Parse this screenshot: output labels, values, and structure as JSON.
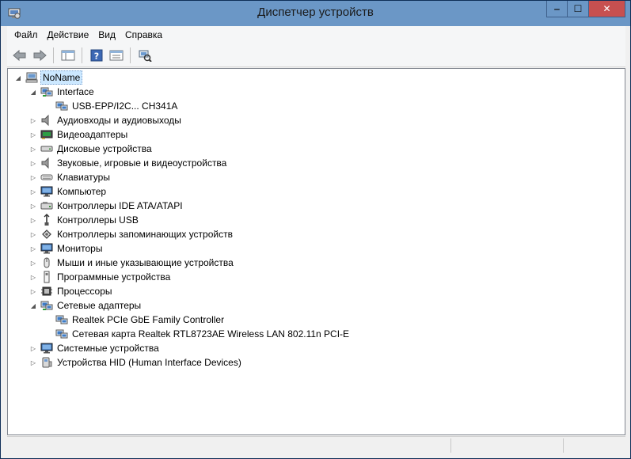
{
  "window": {
    "title": "Диспетчер устройств",
    "minimize_glyph": "‒",
    "maximize_glyph": "☐",
    "close_glyph": "✕"
  },
  "menu": [
    "Файл",
    "Действие",
    "Вид",
    "Справка"
  ],
  "toolbar": {
    "buttons": [
      "back-icon",
      "forward-icon",
      "show-hide-console-tree-icon",
      "help-icon",
      "properties-icon",
      "scan-hardware-icon"
    ]
  },
  "tree": {
    "root": {
      "label": "NoName",
      "icon": "computer-icon",
      "expanded": true
    },
    "items": [
      {
        "label": "Interface",
        "level": 1,
        "expander": "open",
        "icon": "network-icon"
      },
      {
        "label": "USB-EPP/I2C... CH341A",
        "level": 2,
        "expander": "none",
        "icon": "network-device-icon"
      },
      {
        "label": "Аудиовходы и аудиовыходы",
        "level": 1,
        "expander": "closed",
        "icon": "speaker-icon"
      },
      {
        "label": "Видеоадаптеры",
        "level": 1,
        "expander": "closed",
        "icon": "display-adapter-icon"
      },
      {
        "label": "Дисковые устройства",
        "level": 1,
        "expander": "closed",
        "icon": "disk-icon"
      },
      {
        "label": "Звуковые, игровые и видеоустройства",
        "level": 1,
        "expander": "closed",
        "icon": "speaker-icon"
      },
      {
        "label": "Клавиатуры",
        "level": 1,
        "expander": "closed",
        "icon": "keyboard-icon"
      },
      {
        "label": "Компьютер",
        "level": 1,
        "expander": "closed",
        "icon": "monitor-icon"
      },
      {
        "label": "Контроллеры IDE ATA/ATAPI",
        "level": 1,
        "expander": "closed",
        "icon": "ide-controller-icon"
      },
      {
        "label": "Контроллеры USB",
        "level": 1,
        "expander": "closed",
        "icon": "usb-icon"
      },
      {
        "label": "Контроллеры запоминающих устройств",
        "level": 1,
        "expander": "closed",
        "icon": "storage-controller-icon"
      },
      {
        "label": "Мониторы",
        "level": 1,
        "expander": "closed",
        "icon": "monitor-icon"
      },
      {
        "label": "Мыши и иные указывающие устройства",
        "level": 1,
        "expander": "closed",
        "icon": "mouse-icon"
      },
      {
        "label": "Программные устройства",
        "level": 1,
        "expander": "closed",
        "icon": "software-device-icon"
      },
      {
        "label": "Процессоры",
        "level": 1,
        "expander": "closed",
        "icon": "processor-icon"
      },
      {
        "label": "Сетевые адаптеры",
        "level": 1,
        "expander": "open",
        "icon": "network-icon"
      },
      {
        "label": "Realtek PCIe GbE Family Controller",
        "level": 2,
        "expander": "none",
        "icon": "network-device-icon"
      },
      {
        "label": "Сетевая карта Realtek RTL8723AE Wireless LAN 802.11n PCI-E",
        "level": 2,
        "expander": "none",
        "icon": "network-device-icon"
      },
      {
        "label": "Системные устройства",
        "level": 1,
        "expander": "closed",
        "icon": "monitor-icon"
      },
      {
        "label": "Устройства HID (Human Interface Devices)",
        "level": 1,
        "expander": "closed",
        "icon": "hid-icon"
      }
    ]
  }
}
